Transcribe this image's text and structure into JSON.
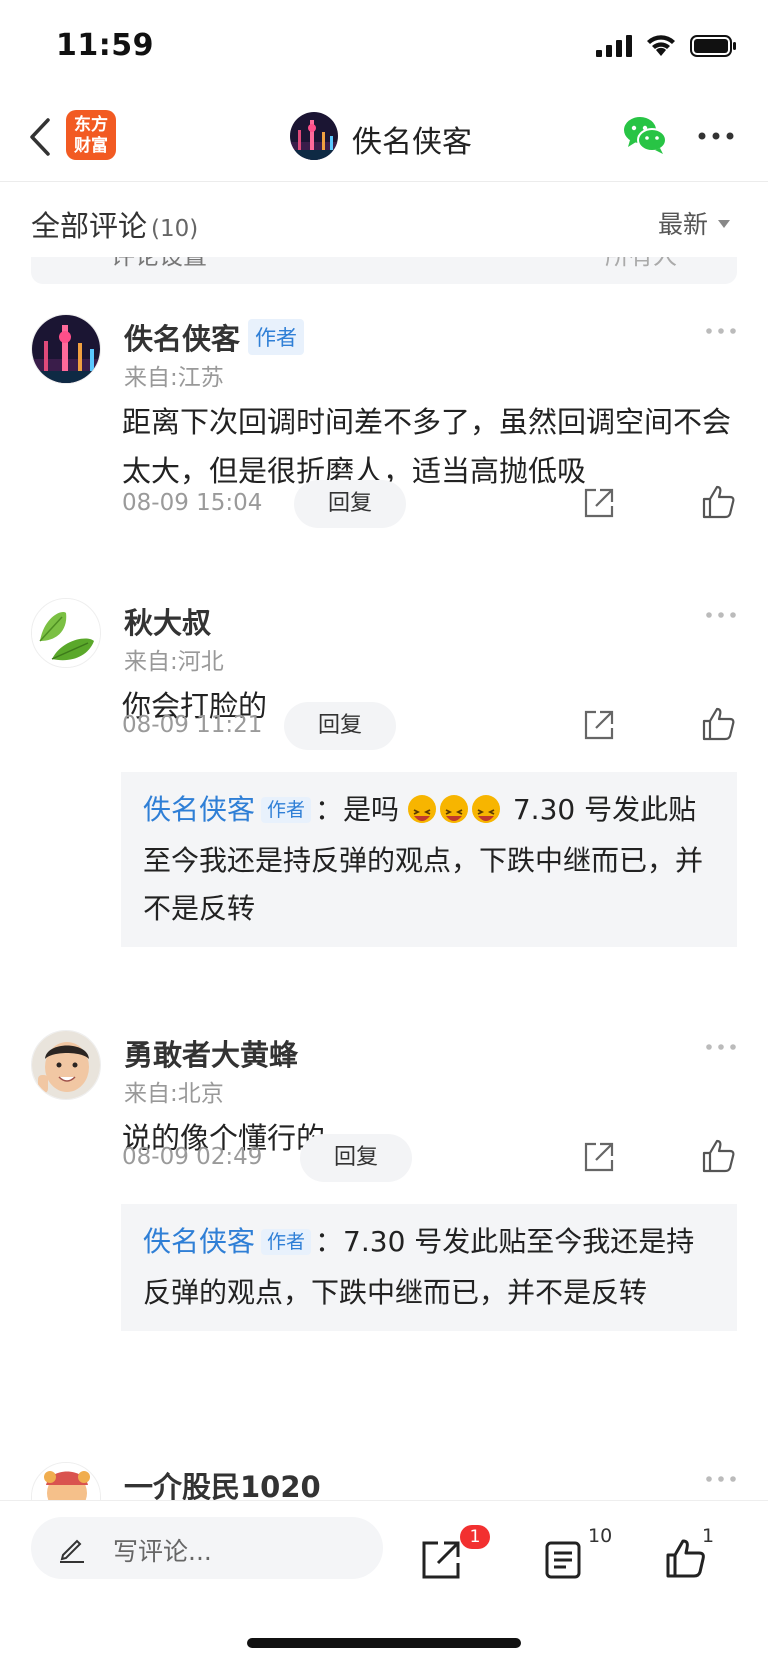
{
  "status_bar": {
    "time": "11:59"
  },
  "nav": {
    "brand_line1": "东方",
    "brand_line2": "财富",
    "title": "佚名侠客",
    "brand_color": "#f25a22",
    "wechat_color": "#28c445"
  },
  "comments_header": {
    "title": "全部评论",
    "count": "(10)",
    "sort_label": "最新"
  },
  "settings_strip": {
    "left_text": "评论设置",
    "right_text": "所有人"
  },
  "comments": [
    {
      "name": "佚名侠客",
      "author_tag": "作者",
      "location": "来自:江苏",
      "text": "距离下次回调时间差不多了，虽然回调空间不会太大，但是很折磨人，适当高抛低吸",
      "time": "08-09 15:04",
      "reply_label": "回复"
    },
    {
      "name": "秋大叔",
      "location": "来自:河北",
      "text": "你会打脸的",
      "time": "08-09 11:21",
      "reply_label": "回复",
      "sub_reply": {
        "name": "佚名侠客",
        "tag": "作者",
        "pre_text": "是吗",
        "post_text": " 7.30 号发此贴至今我还是持反弹的观点，下跌中继而已，并不是反转"
      }
    },
    {
      "name": "勇敢者大黄蜂",
      "location": "来自:北京",
      "text": "说的像个懂行的",
      "time": "08-09 02:49",
      "reply_label": "回复",
      "sub_reply": {
        "name": "佚名侠客",
        "tag": "作者",
        "text": "7.30 号发此贴至今我还是持反弹的观点，下跌中继而已，并不是反转"
      }
    },
    {
      "name": "一介股民1020"
    }
  ],
  "bottom_bar": {
    "input_placeholder": "写评论...",
    "share_badge": "1",
    "comment_count": "10",
    "like_count": "1"
  },
  "colors": {
    "accent_blue": "#2f7fd6",
    "badge_red": "#f23030",
    "muted_text": "#9a9a9a"
  }
}
